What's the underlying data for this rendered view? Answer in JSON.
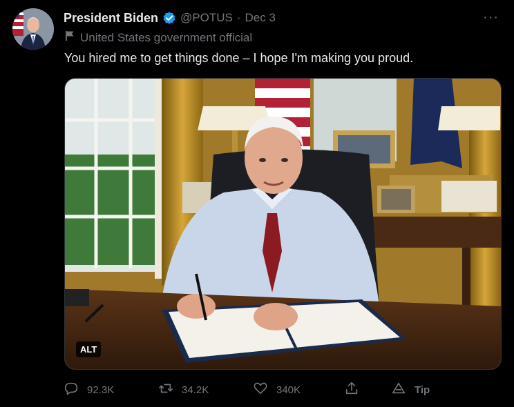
{
  "tweet": {
    "author_name": "President Biden",
    "handle": "@POTUS",
    "separator": "·",
    "date": "Dec 3",
    "label": "United States government official",
    "text": "You hired me to get things done – I hope I'm making you proud.",
    "alt_badge": "ALT",
    "more": "···"
  },
  "actions": {
    "replies": "92.3K",
    "retweets": "34.2K",
    "likes": "340K",
    "tip": "Tip"
  },
  "colors": {
    "background": "#000000",
    "text_primary": "#e7e9ea",
    "text_secondary": "#71767b",
    "verified": "#1d9bf0"
  },
  "icons": {
    "verified": "verified-badge-icon",
    "label": "flag-icon",
    "reply": "reply-icon",
    "retweet": "retweet-icon",
    "like": "heart-icon",
    "share": "share-icon",
    "tip": "tip-icon",
    "more": "more-icon"
  }
}
